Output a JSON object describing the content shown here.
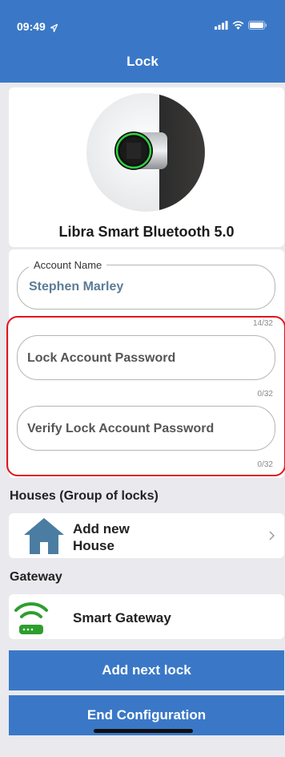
{
  "status_bar": {
    "time": "09:49"
  },
  "header": {
    "title": "Lock"
  },
  "device": {
    "name": "Libra Smart Bluetooth 5.0"
  },
  "form": {
    "account_name": {
      "label": "Account Name",
      "value": "Stephen Marley",
      "counter": "14/32"
    },
    "password": {
      "placeholder": "Lock Account Password",
      "counter": "0/32"
    },
    "verify_password": {
      "placeholder": "Verify Lock Account Password",
      "counter": "0/32"
    }
  },
  "houses": {
    "title": "Houses (Group of locks)",
    "add_line1": "Add new",
    "add_line2": "House",
    "icon": "house-icon"
  },
  "gateway": {
    "title": "Gateway",
    "label": "Smart Gateway",
    "icon": "wifi-gateway-icon"
  },
  "buttons": {
    "add_next": "Add next lock",
    "end": "End Configuration"
  },
  "colors": {
    "accent": "#3a78c7",
    "highlight": "#e0161b",
    "house_icon": "#4a7da1",
    "gateway_icon": "#2e9e2e"
  }
}
